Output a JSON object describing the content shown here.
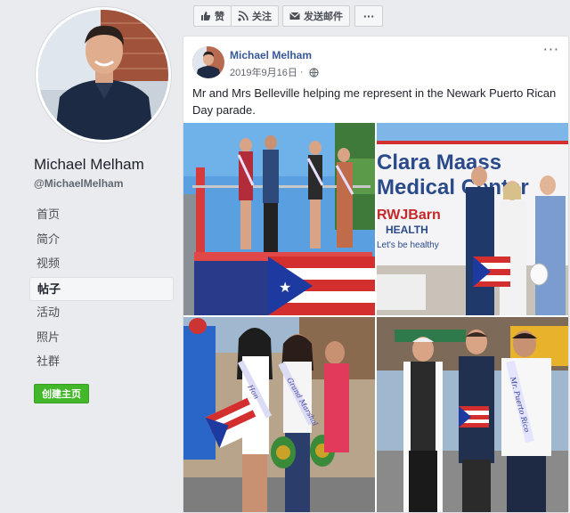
{
  "sidebar": {
    "page_name": "Michael Melham",
    "handle": "@MichaelMelham",
    "nav": [
      "首页",
      "简介",
      "视频",
      "帖子",
      "活动",
      "照片",
      "社群"
    ],
    "active_index": 3,
    "create_button": "创建主页"
  },
  "actionbar": {
    "like": "赞",
    "follow": "关注",
    "message": "发送邮件",
    "more": "···"
  },
  "post": {
    "author": "Michael Melham",
    "date": "2019年9月16日",
    "separator": "·",
    "text": "Mr and Mrs Belleville helping me represent in the Newark Puerto Rican Day parade.",
    "more_label": "···"
  },
  "photo2": {
    "sign_line1": "Clara Maass",
    "sign_line2": "Medical Center",
    "sign_brand": "RWJBarn",
    "sign_sub": "HEALTH",
    "sign_tag": "Let's be healthy"
  },
  "photo3": {
    "sash_left": "Hon",
    "sash_right": "Grand Marshal"
  },
  "photo4": {
    "sash": "Mr. Puerto Rico"
  },
  "colors": {
    "link": "#385898",
    "create_green": "#42b72a",
    "bg": "#e9ebee"
  }
}
